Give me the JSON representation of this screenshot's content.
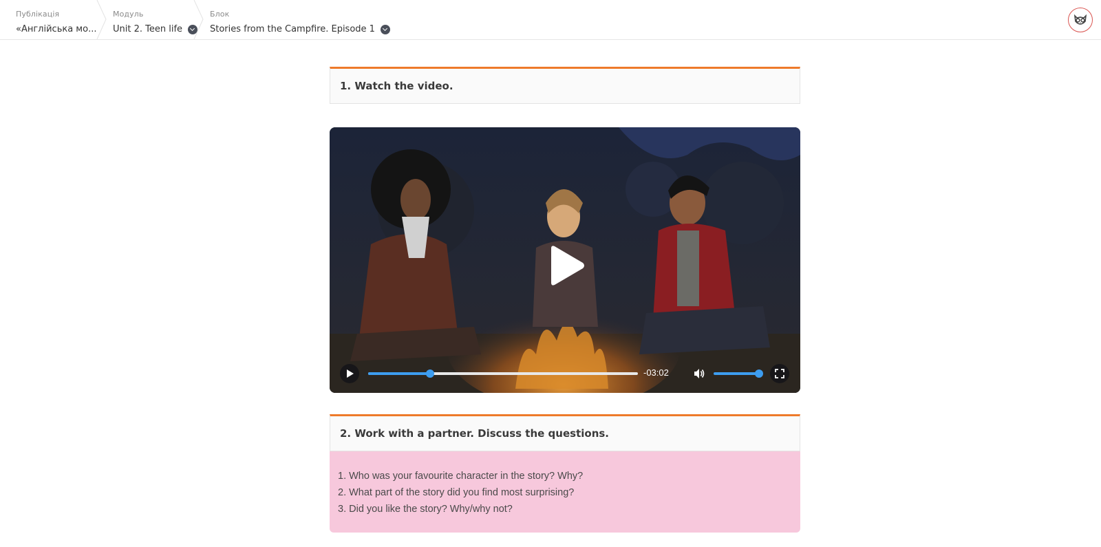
{
  "breadcrumb": {
    "publication": {
      "caption": "Публікація",
      "value": "«Англійська мо..."
    },
    "module": {
      "caption": "Модуль",
      "value": "Unit 2. Teen life"
    },
    "block": {
      "caption": "Блок",
      "value": "Stories from the Campfire. Episode 1"
    }
  },
  "tasks": [
    {
      "title": "1. Watch the video."
    },
    {
      "title": "2. Work with a partner. Discuss the questions."
    }
  ],
  "video": {
    "time_remaining": "-03:02",
    "progress": 0.23,
    "volume": 1.0
  },
  "questions": [
    "1. Who was your favourite character in the story? Why?",
    "2. What part of the story did you find most surprising?",
    "3. Did you like the story? Why/why not?"
  ],
  "colors": {
    "accent": "#ee7a2a",
    "player_blue": "#3d9df0",
    "question_bg": "#f7c8dc"
  }
}
